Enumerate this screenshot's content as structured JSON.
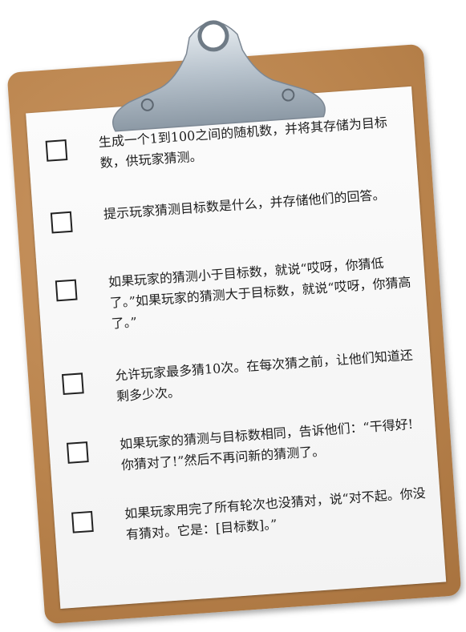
{
  "checklist": {
    "items": [
      {
        "text": "生成一个1到100之间的随机数，并将其存储为目标数，供玩家猜测。",
        "checked": false
      },
      {
        "text": "提示玩家猜测目标数是什么，并存储他们的回答。",
        "checked": false
      },
      {
        "text": "如果玩家的猜测小于目标数，就说“哎呀，你猜低了。”如果玩家的猜测大于目标数，就说“哎呀，你猜高了。”",
        "checked": false
      },
      {
        "text": "允许玩家最多猜10次。在每次猜之前，让他们知道还剩多少次。",
        "checked": false
      },
      {
        "text": "如果玩家的猜测与目标数相同，告诉他们：“干得好!你猜对了!”然后不再问新的猜测了。",
        "checked": false
      },
      {
        "text": "如果玩家用完了所有轮次也没猜对，说“对不起。你没有猜对。它是：[目标数]。”",
        "checked": false
      }
    ]
  },
  "colors": {
    "board": "#b9834c",
    "paper": "#f7f7f7",
    "clip": "#c8d0d8"
  }
}
